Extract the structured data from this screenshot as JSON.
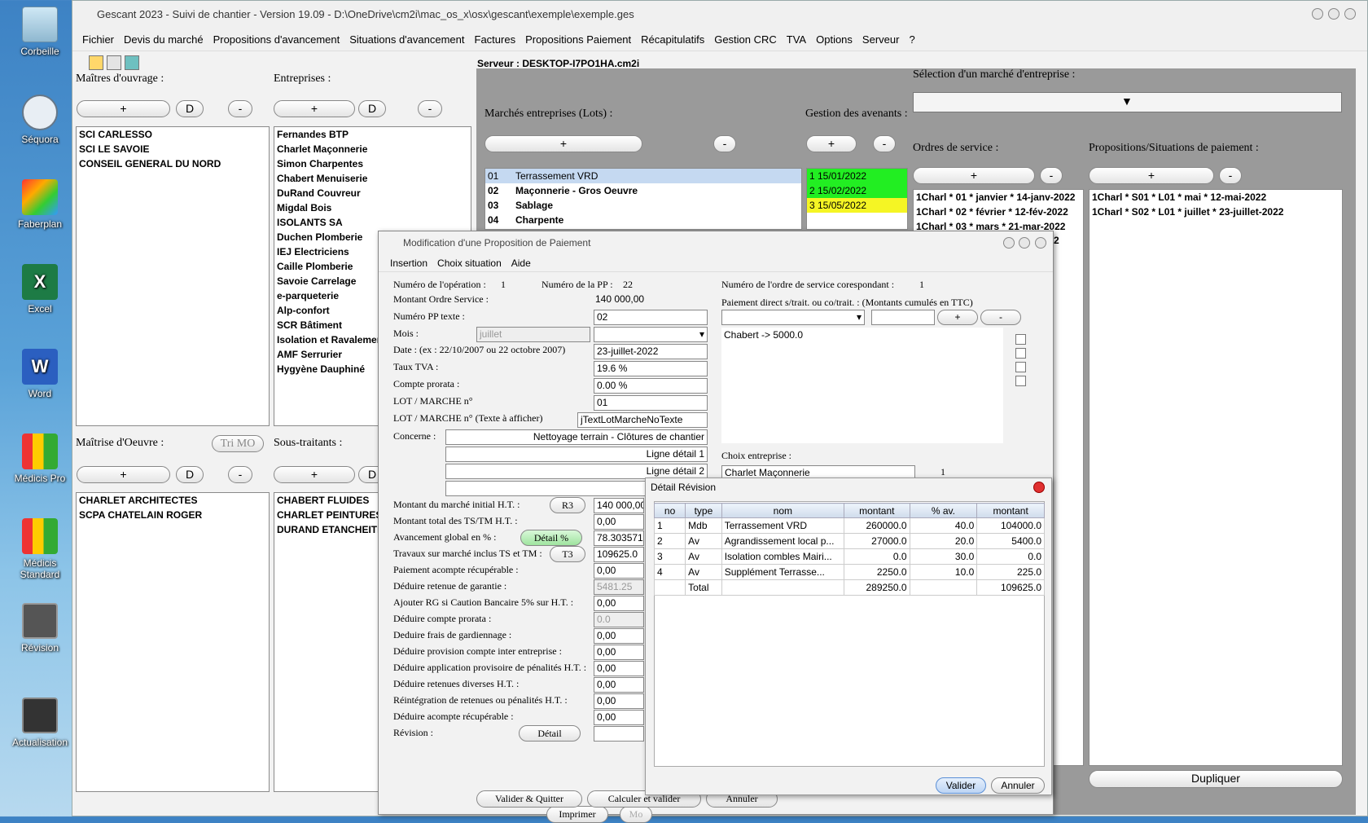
{
  "desktop": {
    "icons": [
      "Corbeille",
      "Séquora",
      "Faberplan",
      "Excel",
      "Word",
      "Médicis Pro",
      "Médicis Standard",
      "Révision",
      "Actualisation"
    ]
  },
  "app": {
    "title": "Gescant 2023 - Suivi de chantier - Version 19.09 - D:\\OneDrive\\cm2i\\mac_os_x\\osx\\gescant\\exemple\\exemple.ges",
    "menu": [
      "Fichier",
      "Devis du marché",
      "Propositions d'avancement",
      "Situations d'avancement",
      "Factures",
      "Propositions Paiement",
      "Récapitulatifs",
      "Gestion CRC",
      "TVA",
      "Options",
      "Serveur",
      "?"
    ],
    "server_label": "Serveur : DESKTOP-I7PO1HA.cm2i"
  },
  "left": {
    "maitres_label": "Maîtres d'ouvrage :",
    "entreprises_label": "Entreprises :",
    "plus": "+",
    "d": "D",
    "minus": "-",
    "maitres": [
      "SCI CARLESSO",
      "SCI LE SAVOIE",
      "CONSEIL GENERAL DU NORD"
    ],
    "entreprises": [
      "Fernandes BTP",
      "Charlet Maçonnerie",
      "Simon Charpentes",
      "Chabert Menuiserie",
      "DuRand Couvreur",
      "Migdal Bois",
      "ISOLANTS SA",
      "Duchen Plomberie",
      "IEJ Electriciens",
      "Caille Plomberie",
      "Savoie Carrelage",
      "e-parqueterie",
      "Alp-confort",
      "SCR Bâtiment",
      "Isolation et Ravalement",
      "AMF Serrurier",
      "Hygyène Dauphiné"
    ],
    "maitrise_label": "Maîtrise d'Oeuvre :",
    "tri_mo": "Tri MO",
    "sous_label": "Sous-traitants :",
    "maitrise": [
      "CHARLET ARCHITECTES",
      "SCPA CHATELAIN ROGER"
    ],
    "sous": [
      "CHABERT FLUIDES",
      "CHARLET PEINTURES",
      "DURAND ETANCHEITE"
    ]
  },
  "right": {
    "selection_label": "Sélection d'un marché d'entreprise :",
    "marches_label": "Marchés entreprises (Lots) :",
    "avenants_label": "Gestion des avenants :",
    "ordres_label": "Ordres de service :",
    "propositions_label": "Propositions/Situations de paiement :",
    "lots": [
      {
        "no": "01",
        "name": "Terrassement VRD"
      },
      {
        "no": "02",
        "name": "Maçonnerie - Gros Oeuvre"
      },
      {
        "no": "03",
        "name": "Sablage"
      },
      {
        "no": "04",
        "name": "Charpente"
      }
    ],
    "avenants": [
      "1 15/01/2022",
      "2 15/02/2022",
      "3 15/05/2022"
    ],
    "ordres": [
      "1Charl * 01 * janvier * 14-janv-2022",
      "1Charl * 02 * février * 12-fév-2022",
      "1Charl * 03 * mars * 21-mar-2022"
    ],
    "ordres_partial": "2",
    "propositions": [
      "1Charl * S01 * L01 * mai * 12-mai-2022",
      "1Charl * S02 * L01 * juillet * 23-juillet-2022"
    ],
    "dupliquer": "Dupliquer"
  },
  "modal": {
    "title": "Modification d'une Proposition de Paiement",
    "menu": [
      "Insertion",
      "Choix situation",
      "Aide"
    ],
    "num_op_label": "Numéro de l'opération :",
    "num_op": "1",
    "num_pp_label": "Numéro de la PP :",
    "num_pp": "22",
    "num_os_label": "Numéro de l'ordre de service corespondant :",
    "num_os": "1",
    "montant_os_label": "Montant Ordre Service :",
    "montant_os": "140 000,00",
    "paiement_direct_label": "Paiement direct s/trait. ou co/trait. : (Montants cumulés en TTC)",
    "pp_texte_label": "Numéro PP texte :",
    "pp_texte": "02",
    "mois_label": "Mois :",
    "mois": "juillet",
    "date_label": "Date : (ex : 22/10/2007 ou 22 octobre 2007)",
    "date": "23-juillet-2022",
    "tva_label": "Taux TVA :",
    "tva": "19.6 %",
    "prorata_label": "Compte prorata :",
    "prorata": "0.00 %",
    "lot_label": "LOT / MARCHE n°",
    "lot": "01",
    "lot_texte_label": "LOT / MARCHE n° (Texte à afficher)",
    "lot_texte": "jTextLotMarcheNoTexte",
    "concerne_label": "Concerne :",
    "concerne": "Nettoyage terrain - Clôtures de chantier",
    "ligne1": "Ligne détail 1",
    "ligne2": "Ligne détail 2",
    "paiement_item": "Chabert -> 5000.0",
    "choix_entreprise_label": "Choix entreprise :",
    "choix_entreprise": "Charlet Maçonnerie",
    "choix_num": "1",
    "rows": [
      {
        "label": "Montant du marché initial H.T. :",
        "btn": "R3",
        "value": "140 000,00"
      },
      {
        "label": "Montant total des TS/TM H.T. :",
        "value": "0,00"
      },
      {
        "label": "Avancement global en % :",
        "btn": "Détail %",
        "value": "78.303571"
      },
      {
        "label": "Travaux sur marché inclus TS et TM :",
        "btn": "T3",
        "value": "109625.0"
      },
      {
        "label": "Paiement acompte récupérable :",
        "value": "0,00"
      },
      {
        "label": "Déduire retenue de garantie :",
        "value": "5481.25",
        "dis": true
      },
      {
        "label": "Ajouter RG si Caution Bancaire 5% sur H.T. :",
        "value": "0,00"
      },
      {
        "label": "Déduire compte prorata :",
        "value": "0.0",
        "dis": true
      },
      {
        "label": "Deduire frais de gardiennage :",
        "value": "0,00"
      },
      {
        "label": "Déduire provision compte inter entreprise :",
        "value": "0,00"
      },
      {
        "label": "Déduire application provisoire de pénalités H.T. :",
        "value": "0,00"
      },
      {
        "label": "Déduire retenues diverses H.T. :",
        "value": "0,00"
      },
      {
        "label": "Réintégration de retenues ou pénalités H.T. :",
        "value": "0,00"
      },
      {
        "label": "Déduire acompte récupérable :",
        "value": "0,00"
      },
      {
        "label": "Révision :",
        "btn": "Détail",
        "value": ""
      }
    ],
    "imprimer": "Imprimer",
    "mo_partial": "Mo",
    "valider_quitter": "Valider & Quitter",
    "calculer": "Calculer et valider",
    "annuler": "Annuler"
  },
  "revision": {
    "title": "Détail Révision",
    "headers": [
      "no",
      "type",
      "nom",
      "montant",
      "% av.",
      "montant"
    ],
    "rows": [
      [
        "1",
        "Mdb",
        "Terrassement VRD",
        "260000.0",
        "40.0",
        "104000.0"
      ],
      [
        "2",
        "Av",
        "Agrandissement local p...",
        "27000.0",
        "20.0",
        "5400.0"
      ],
      [
        "3",
        "Av",
        "Isolation combles Mairi...",
        "0.0",
        "30.0",
        "0.0"
      ],
      [
        "4",
        "Av",
        "Supplément Terrasse...",
        "2250.0",
        "10.0",
        "225.0"
      ],
      [
        "",
        "Total",
        "",
        "289250.0",
        "",
        "109625.0"
      ]
    ],
    "valider": "Valider",
    "annuler": "Annuler"
  },
  "colors": {
    "green": "#22ee22",
    "yellow": "#f5f524",
    "select": "#c5d9f1",
    "accent": "#2d6fd6"
  }
}
